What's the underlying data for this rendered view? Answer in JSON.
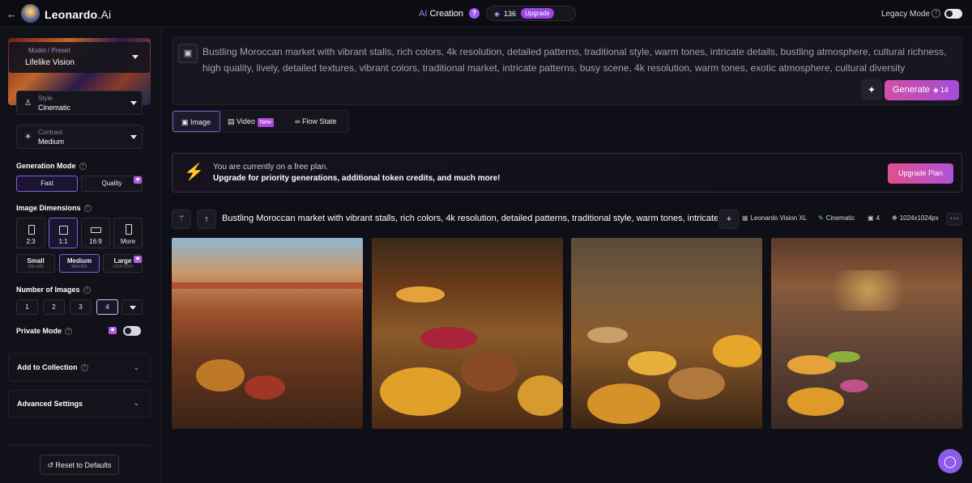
{
  "topbar": {
    "back_icon": "←",
    "brand_main": "Leonardo",
    "brand_suffix": ".Ai",
    "mode_prefix": "AI",
    "mode_label": "Creation",
    "help": "?",
    "tokens": "136",
    "upgrade": "Upgrade",
    "legacy_label": "Legacy Mode",
    "legacy_help": "?"
  },
  "sidebar": {
    "model_label": "Model / Preset",
    "model_value": "Lifelike Vision",
    "style_label": "Style",
    "style_value": "Cinematic",
    "contrast_label": "Contrast",
    "contrast_value": "Medium",
    "generation_mode_title": "Generation Mode",
    "modes": [
      "Fast",
      "Quality"
    ],
    "image_dimensions_title": "Image Dimensions",
    "ratios": [
      "2:3",
      "1:1",
      "16:9",
      "More"
    ],
    "sizes": [
      {
        "label": "Small",
        "sub": "688×688"
      },
      {
        "label": "Medium",
        "sub": "960×960"
      },
      {
        "label": "Large",
        "sub": "1024×1024"
      }
    ],
    "number_of_images_title": "Number of Images",
    "counts": [
      "1",
      "2",
      "3",
      "4"
    ],
    "private_mode": "Private Mode",
    "add_collection": "Add to Collection",
    "advanced_settings": "Advanced Settings",
    "reset": "Reset to Defaults",
    "q": "?"
  },
  "prompt": {
    "text": "Bustling Moroccan market with vibrant stalls, rich colors, 4k resolution, detailed patterns, traditional style, warm tones, intricate details, bustling atmosphere, cultural richness, high quality, lively, detailed textures, vibrant colors, traditional market, intricate patterns, busy scene, 4k resolution, warm tones, exotic atmosphere, cultural diversity",
    "generate": "Generate",
    "generate_cost": "14"
  },
  "tabs": {
    "image": "Image",
    "video": "Video",
    "video_badge": "New",
    "flow": "Flow State"
  },
  "banner": {
    "line1": "You are currently on a free plan.",
    "line2": "Upgrade for priority generations, additional token credits, and much more!",
    "button": "Upgrade Plan"
  },
  "generation": {
    "title": "Bustling Moroccan market with vibrant stalls, rich colors, 4k resolution, detailed patterns, traditional style, warm tones, intricate...",
    "model": "Leonardo Vision XL",
    "style": "Cinematic",
    "count": "4",
    "size": "1024x1024px"
  },
  "colors": {
    "accent": "#a64cd8",
    "pink": "#d34fa6",
    "bg": "#0f0f17"
  }
}
